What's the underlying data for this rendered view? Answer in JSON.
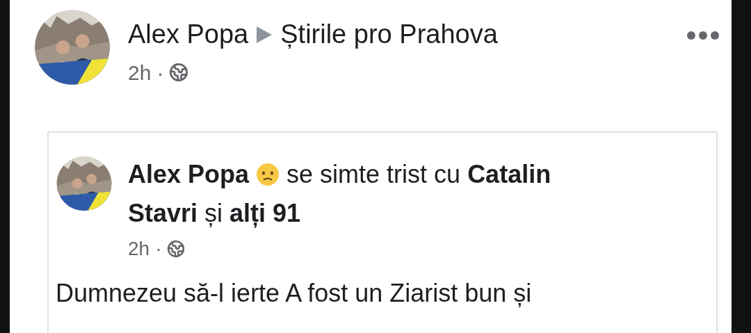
{
  "post": {
    "author": "Alex Popa",
    "target": "Știrile pro Prahova",
    "time": "2h",
    "separator": "·"
  },
  "shared_post": {
    "author": "Alex Popa",
    "activity_lines": [
      "se simte trist cu **Catalin**",
      "**Stavri** și **alți 91**"
    ],
    "time": "2h",
    "separator": "·",
    "text": "Dumnezeu să-l ierte A fost un Ziarist bun și"
  }
}
